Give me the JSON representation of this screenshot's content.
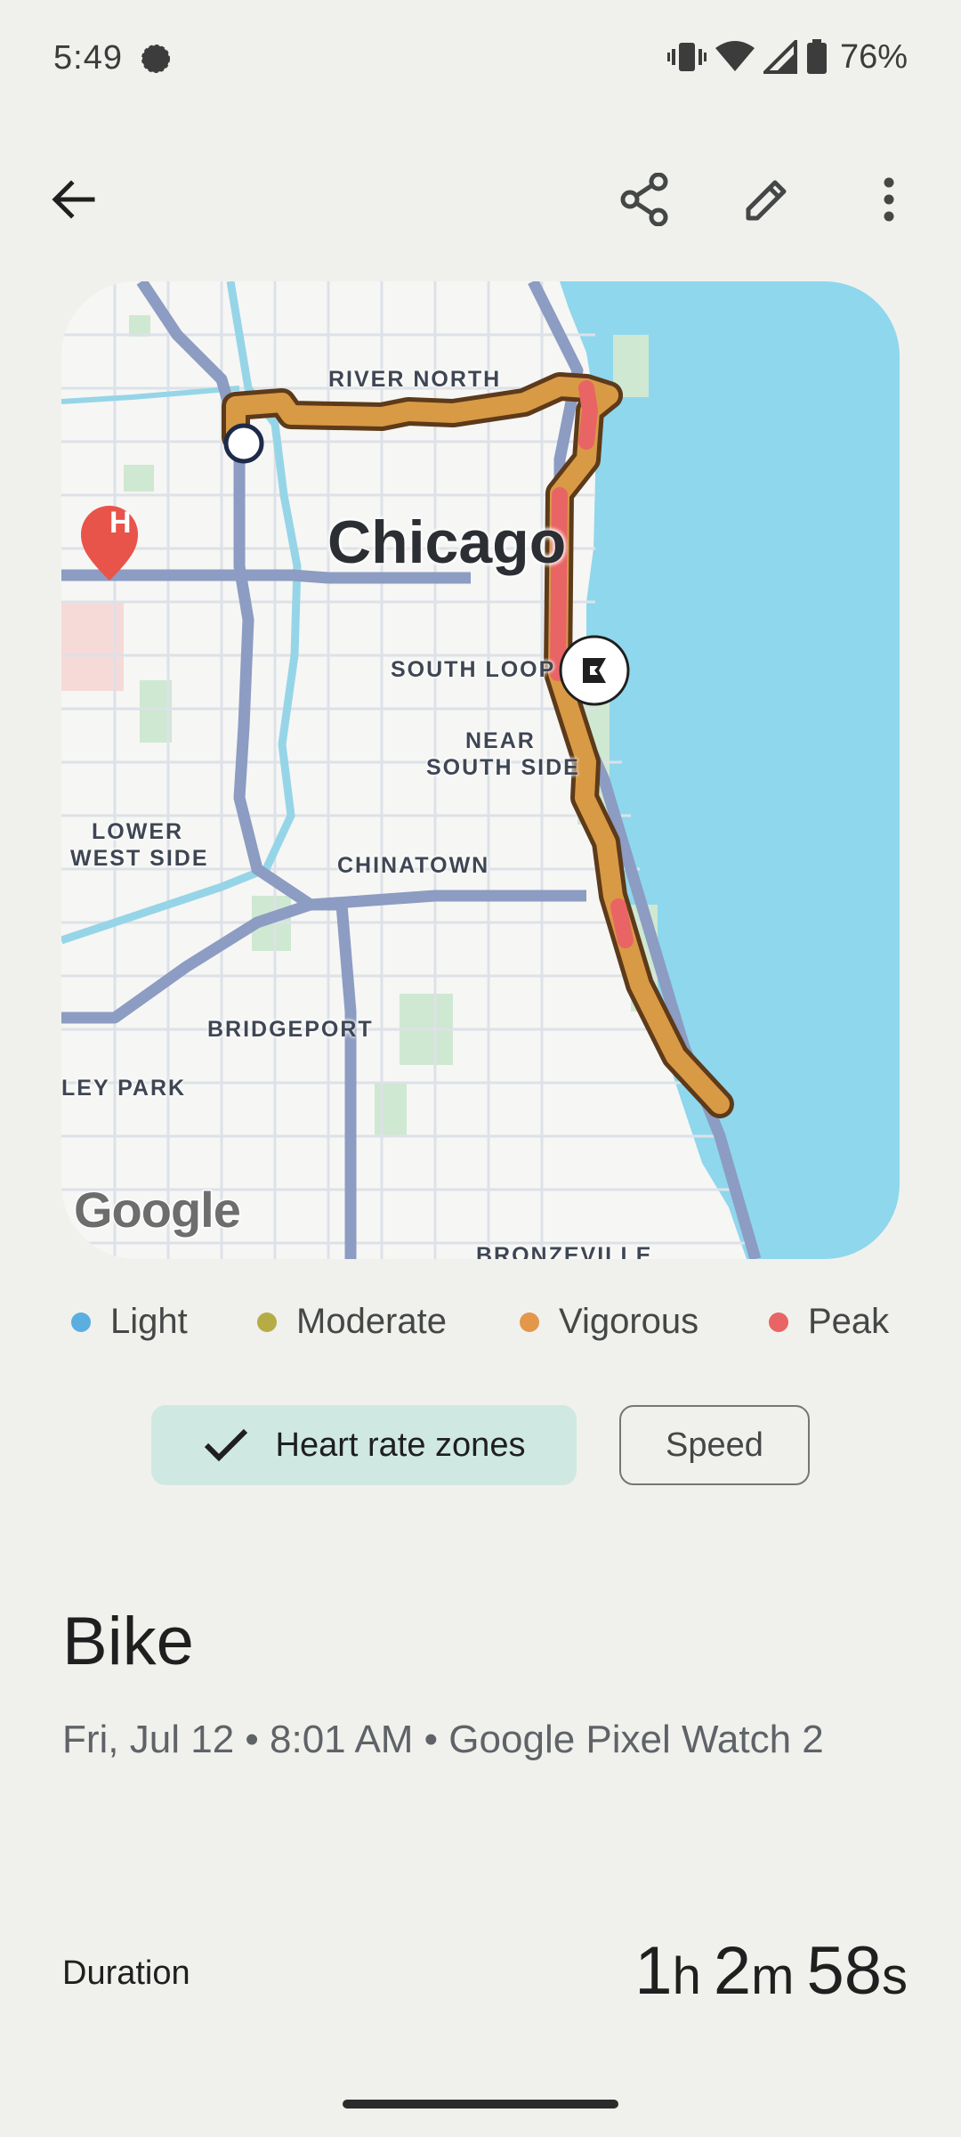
{
  "status_bar": {
    "time": "5:49",
    "battery": "76%",
    "icons": [
      "notification-icon",
      "vibrate-icon",
      "wifi-icon",
      "signal-icon",
      "battery-icon"
    ]
  },
  "app_bar": {
    "icons": [
      "back-arrow-icon",
      "share-icon",
      "edit-icon",
      "more-vert-icon"
    ]
  },
  "map": {
    "city": "Chicago",
    "labels": {
      "river_north": "RIVER NORTH",
      "south_loop": "SOUTH LOOP",
      "near_south_side_1": "NEAR",
      "near_south_side_2": "SOUTH SIDE",
      "lower_west_side_1": "LOWER",
      "lower_west_side_2": "WEST SIDE",
      "chinatown": "CHINATOWN",
      "bridgeport": "BRIDGEPORT",
      "mckinley_park": "LEY PARK",
      "bronzeville": "BRONZEVILLE"
    },
    "attribution": "Google",
    "hospital_marker": "H"
  },
  "legend": [
    {
      "label": "Light",
      "color": "#5aaee0"
    },
    {
      "label": "Moderate",
      "color": "#b5ac45"
    },
    {
      "label": "Vigorous",
      "color": "#e3974a"
    },
    {
      "label": "Peak",
      "color": "#e96464"
    }
  ],
  "chips": {
    "heart_rate": "Heart rate zones",
    "speed": "Speed"
  },
  "activity": {
    "title": "Bike",
    "subtitle": "Fri, Jul 12 • 8:01 AM • Google Pixel Watch 2"
  },
  "stats": {
    "duration_label": "Duration",
    "duration": {
      "h": "1",
      "h_unit": "h",
      "m": "2",
      "m_unit": "m",
      "s": "58",
      "s_unit": "s"
    }
  },
  "colors": {
    "background": "#f0f1ed",
    "route_vigorous": "#d99a45",
    "route_peak": "#e96464",
    "water": "#8fd7ec",
    "chip_selected": "#cfe9e2"
  }
}
